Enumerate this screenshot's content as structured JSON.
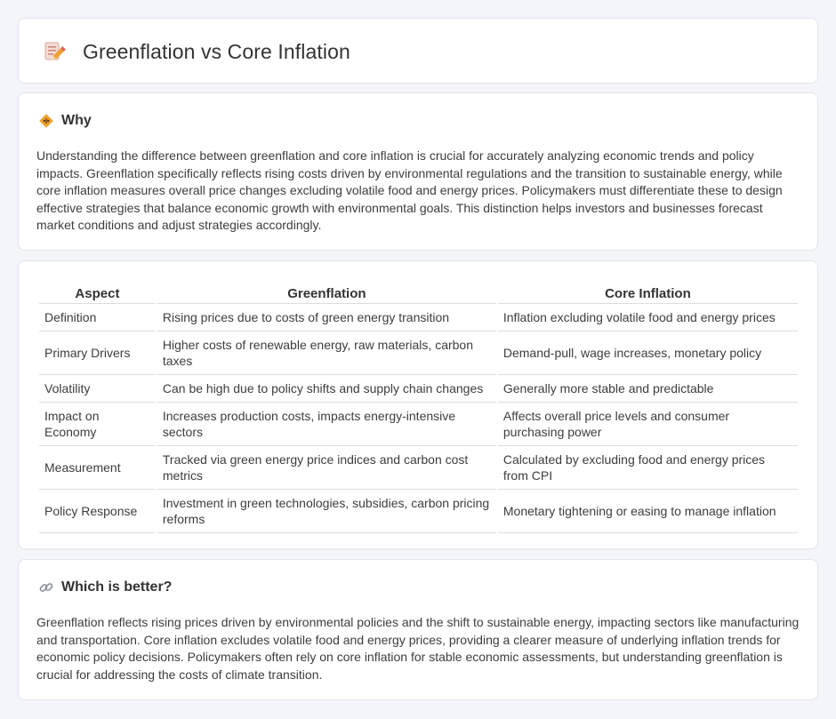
{
  "header": {
    "title": "Greenflation vs Core Inflation",
    "icon": "pencil-document-icon"
  },
  "why": {
    "heading": "Why",
    "icon": "diamond-warning-icon",
    "text": "Understanding the difference between greenflation and core inflation is crucial for accurately analyzing economic trends and policy impacts. Greenflation specifically reflects rising costs driven by environmental regulations and the transition to sustainable energy, while core inflation measures overall price changes excluding volatile food and energy prices. Policymakers must differentiate these to design effective strategies that balance economic growth with environmental goals. This distinction helps investors and businesses forecast market conditions and adjust strategies accordingly."
  },
  "comparison": {
    "columns": [
      "Aspect",
      "Greenflation",
      "Core Inflation"
    ],
    "rows": [
      [
        "Definition",
        "Rising prices due to costs of green energy transition",
        "Inflation excluding volatile food and energy prices"
      ],
      [
        "Primary Drivers",
        "Higher costs of renewable energy, raw materials, carbon taxes",
        "Demand-pull, wage increases, monetary policy"
      ],
      [
        "Volatility",
        "Can be high due to policy shifts and supply chain changes",
        "Generally more stable and predictable"
      ],
      [
        "Impact on Economy",
        "Increases production costs, impacts energy-intensive sectors",
        "Affects overall price levels and consumer purchasing power"
      ],
      [
        "Measurement",
        "Tracked via green energy price indices and carbon cost metrics",
        "Calculated by excluding food and energy prices from CPI"
      ],
      [
        "Policy Response",
        "Investment in green technologies, subsidies, carbon pricing reforms",
        "Monetary tightening or easing to manage inflation"
      ]
    ]
  },
  "better": {
    "heading": "Which is better?",
    "icon": "link-icon",
    "text": "Greenflation reflects rising prices driven by environmental policies and the shift to sustainable energy, impacting sectors like manufacturing and transportation. Core inflation excludes volatile food and energy prices, providing a clearer measure of underlying inflation trends for economic policy decisions. Policymakers often rely on core inflation for stable economic assessments, but understanding greenflation is crucial for addressing the costs of climate transition."
  },
  "colors": {
    "background": "#f4f5f8",
    "card": "#ffffff",
    "border": "#e2e4ea",
    "accent": "#f0a030"
  }
}
